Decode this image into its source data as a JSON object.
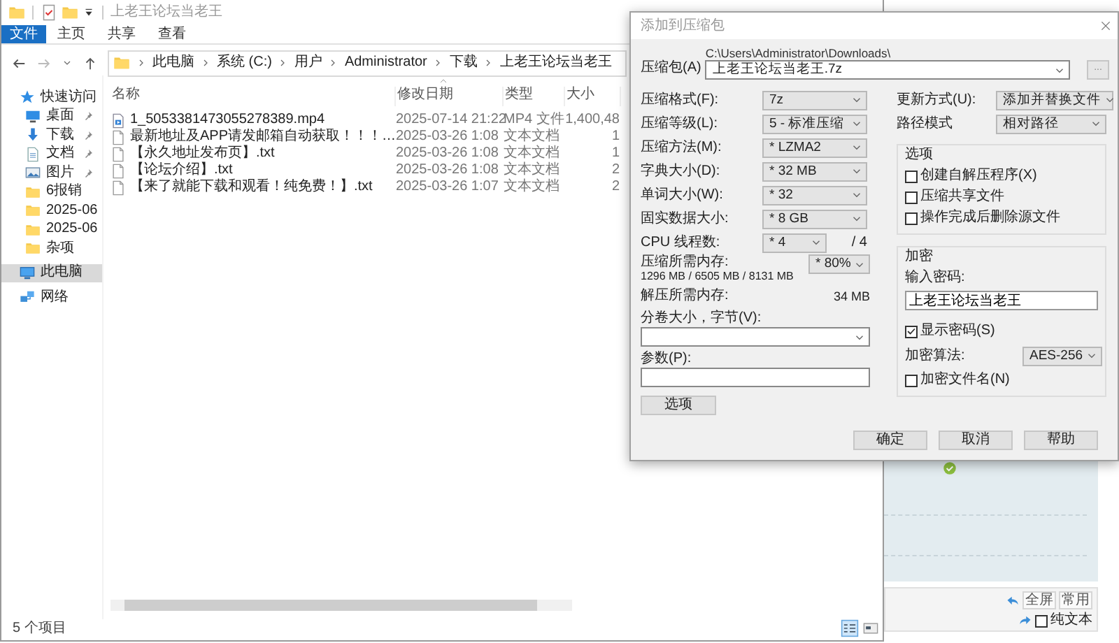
{
  "explorer": {
    "title": "上老王论坛当老王",
    "ribbon_tabs": [
      {
        "label": "文件",
        "selected": true
      },
      {
        "label": "主页",
        "selected": false
      },
      {
        "label": "共享",
        "selected": false
      },
      {
        "label": "查看",
        "selected": false
      }
    ],
    "breadcrumb": [
      "此电脑",
      "系统 (C:)",
      "用户",
      "Administrator",
      "下载",
      "上老王论坛当老王"
    ],
    "nav_items": [
      {
        "label": "快速访问",
        "kind": "star",
        "pinned": false,
        "selected": false
      },
      {
        "label": "桌面",
        "kind": "desktop",
        "pinned": true,
        "selected": false
      },
      {
        "label": "下载",
        "kind": "download",
        "pinned": true,
        "selected": false
      },
      {
        "label": "文档",
        "kind": "document",
        "pinned": true,
        "selected": false
      },
      {
        "label": "图片",
        "kind": "picture",
        "pinned": true,
        "selected": false
      },
      {
        "label": "6报销",
        "kind": "folder",
        "pinned": false,
        "selected": false
      },
      {
        "label": "2025-06",
        "kind": "folder",
        "pinned": false,
        "selected": false
      },
      {
        "label": "2025-06",
        "kind": "folder",
        "pinned": false,
        "selected": false
      },
      {
        "label": "杂项",
        "kind": "folder",
        "pinned": false,
        "selected": false
      },
      {
        "label": "此电脑",
        "kind": "pc",
        "pinned": false,
        "selected": true
      },
      {
        "label": "网络",
        "kind": "network",
        "pinned": false,
        "selected": false
      }
    ],
    "columns": [
      {
        "label": "名称",
        "sorted": false
      },
      {
        "label": "修改日期",
        "sorted": true
      },
      {
        "label": "类型",
        "sorted": false
      },
      {
        "label": "大小",
        "sorted": false
      }
    ],
    "rows": [
      {
        "name": "1_5053381473055278389.mp4",
        "date": "2025-07-14 21:22",
        "type": "MP4 文件",
        "size": "1,400,48",
        "kind": "video"
      },
      {
        "name": "最新地址及APP请发邮箱自动获取！！！…",
        "date": "2025-03-26 1:08",
        "type": "文本文档",
        "size": "1",
        "kind": "text"
      },
      {
        "name": "【永久地址发布页】.txt",
        "date": "2025-03-26 1:08",
        "type": "文本文档",
        "size": "1",
        "kind": "text"
      },
      {
        "name": "【论坛介绍】.txt",
        "date": "2025-03-26 1:08",
        "type": "文本文档",
        "size": "2",
        "kind": "text"
      },
      {
        "name": "【来了就能下载和观看！纯免费！】.txt",
        "date": "2025-03-26 1:07",
        "type": "文本文档",
        "size": "2",
        "kind": "text"
      }
    ],
    "status": "5 个项目"
  },
  "dialog": {
    "title": "添加到压缩包",
    "archive_label": "压缩包(A)",
    "archive_path": "C:\\Users\\Administrator\\Downloads\\",
    "archive_name": "上老王论坛当老王.7z",
    "browse": "...",
    "left_rows": [
      {
        "kind": "combo",
        "label": "压缩格式(F):",
        "value": "7z"
      },
      {
        "kind": "combo",
        "label": "压缩等级(L):",
        "value": "5 - 标准压缩"
      },
      {
        "kind": "combo",
        "label": "压缩方法(M):",
        "value": "* LZMA2"
      },
      {
        "kind": "combo",
        "label": "字典大小(D):",
        "value": "* 32 MB"
      },
      {
        "kind": "combo",
        "label": "单词大小(W):",
        "value": "* 32"
      },
      {
        "kind": "combo",
        "label": "固实数据大小:",
        "value": "* 8 GB"
      },
      {
        "kind": "combo",
        "label": "CPU 线程数:",
        "value": "* 4",
        "suffix": "/ 4"
      },
      {
        "kind": "memory",
        "label": "压缩所需内存:",
        "detail": "1296 MB / 6505 MB / 8131 MB",
        "value": "* 80%"
      },
      {
        "kind": "info",
        "label": "解压所需内存:",
        "value": "34 MB"
      }
    ],
    "volume_label": "分卷大小，字节(V):",
    "params_label": "参数(P):",
    "options_button": "选项",
    "update": {
      "label": "更新方式(U):",
      "value": "添加并替换文件"
    },
    "path_mode": {
      "label": "路径模式",
      "value": "相对路径"
    },
    "options": {
      "title": "选项",
      "checks": [
        {
          "label": "创建自解压程序(X)",
          "checked": false
        },
        {
          "label": "压缩共享文件",
          "checked": false
        },
        {
          "label": "操作完成后删除源文件",
          "checked": false
        }
      ]
    },
    "encryption": {
      "title": "加密",
      "password_label": "输入密码:",
      "password": "上老王论坛当老王",
      "show_password": {
        "label": "显示密码(S)",
        "checked": true
      },
      "method_label": "加密算法:",
      "method": "AES-256",
      "encrypt_names": {
        "label": "加密文件名(N)",
        "checked": false
      }
    },
    "buttons": [
      "确定",
      "取消",
      "帮助"
    ]
  },
  "background_page": {
    "buttons": [
      "全屏",
      "常用"
    ],
    "plain_text": {
      "label": "纯文本",
      "checked": false
    }
  }
}
